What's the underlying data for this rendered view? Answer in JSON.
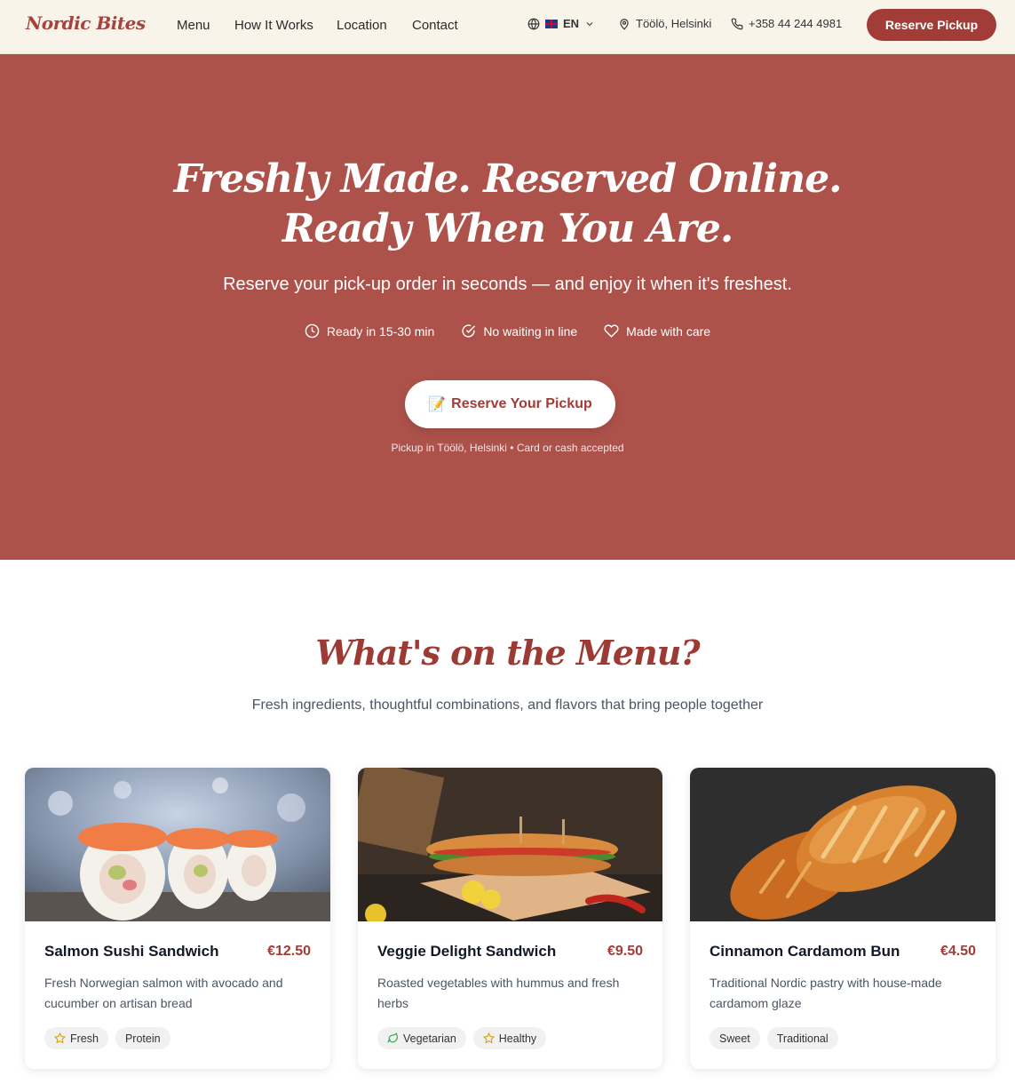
{
  "header": {
    "logo": "Nordic Bites",
    "nav": [
      "Menu",
      "How It Works",
      "Location",
      "Contact"
    ],
    "language": "EN",
    "location": "Töölö, Helsinki",
    "phone": "+358 44 244 4981",
    "cta_label": "Reserve Pickup"
  },
  "hero": {
    "title_line1": "Freshly Made. Reserved Online.",
    "title_line2": "Ready When You Are.",
    "subtitle": "Reserve your pick-up order in seconds — and enjoy it when it's freshest.",
    "features": [
      "Ready in 15-30 min",
      "No waiting in line",
      "Made with care"
    ],
    "cta_emoji": "📝",
    "cta_label": "Reserve Your Pickup",
    "note": "Pickup in Töölö, Helsinki • Card or cash accepted"
  },
  "menu": {
    "title": "What's on the Menu?",
    "subtitle": "Fresh ingredients, thoughtful combinations, and flavors that bring people together",
    "items": [
      {
        "name": "Salmon Sushi Sandwich",
        "price": "€12.50",
        "description": "Fresh Norwegian salmon with avocado and cucumber on artisan bread",
        "tags": [
          "Fresh",
          "Protein"
        ]
      },
      {
        "name": "Veggie Delight Sandwich",
        "price": "€9.50",
        "description": "Roasted vegetables with hummus and fresh herbs",
        "tags": [
          "Vegetarian",
          "Healthy"
        ]
      },
      {
        "name": "Cinnamon Cardamom Bun",
        "price": "€4.50",
        "description": "Traditional Nordic pastry with house-made cardamom glaze",
        "tags": [
          "Sweet",
          "Traditional"
        ]
      }
    ]
  },
  "colors": {
    "brand": "#a23c36",
    "hero_background": "#ad524b",
    "header_background": "#f8f4ea"
  }
}
